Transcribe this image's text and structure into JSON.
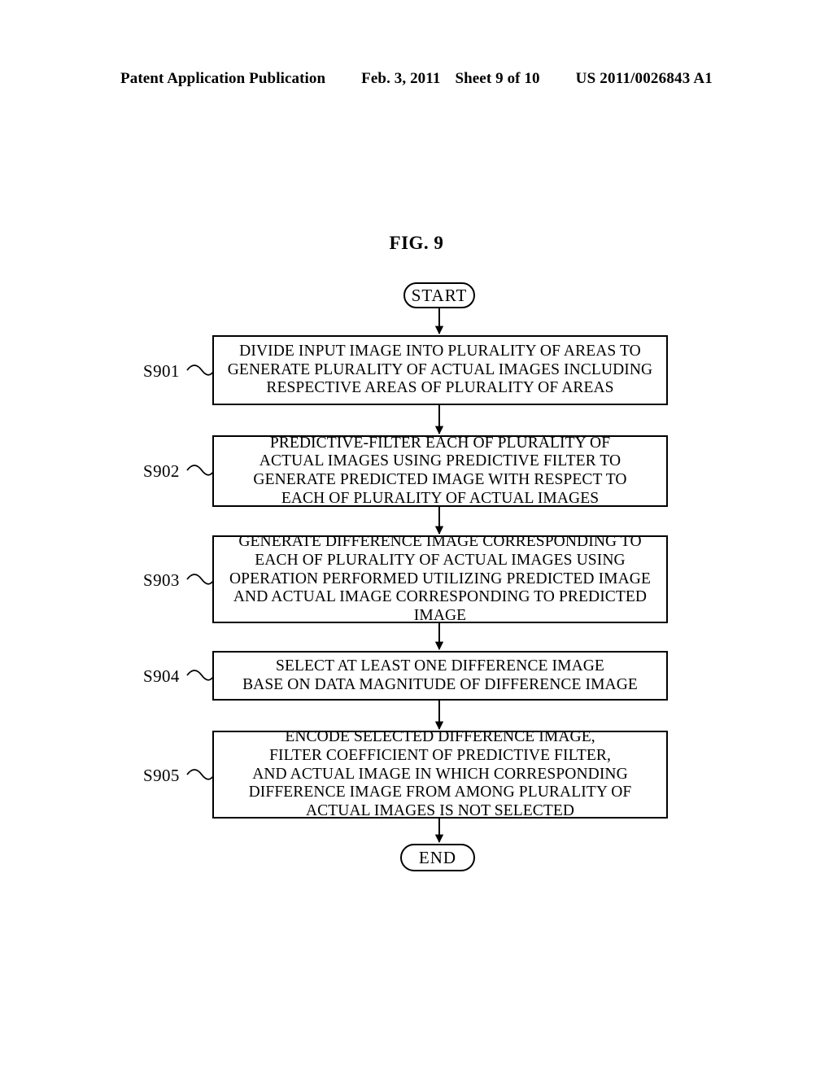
{
  "header": {
    "publication": "Patent Application Publication",
    "date": "Feb. 3, 2011",
    "sheet": "Sheet 9 of 10",
    "patent_number": "US 2011/0026843 A1"
  },
  "figure": {
    "title": "FIG. 9"
  },
  "flowchart": {
    "start_label": "START",
    "end_label": "END",
    "steps": [
      {
        "ref": "S901",
        "text": "DIVIDE INPUT IMAGE INTO PLURALITY OF AREAS TO\nGENERATE PLURALITY OF ACTUAL IMAGES INCLUDING\nRESPECTIVE AREAS OF PLURALITY OF AREAS"
      },
      {
        "ref": "S902",
        "text": "PREDICTIVE-FILTER EACH OF PLURALITY OF\nACTUAL IMAGES USING PREDICTIVE FILTER TO\nGENERATE PREDICTED  IMAGE WITH RESPECT TO\nEACH OF PLURALITY OF ACTUAL IMAGES"
      },
      {
        "ref": "S903",
        "text": "GENERATE DIFFERENCE IMAGE CORRESPONDING TO\nEACH OF PLURALITY OF ACTUAL IMAGES USING\nOPERATION PERFORMED UTILIZING PREDICTED  IMAGE\nAND ACTUAL IMAGE CORRESPONDING TO PREDICTED\nIMAGE"
      },
      {
        "ref": "S904",
        "text": "SELECT AT LEAST ONE DIFFERENCE IMAGE\nBASE ON DATA MAGNITUDE OF DIFFERENCE IMAGE"
      },
      {
        "ref": "S905",
        "text": "ENCODE SELECTED DIFFERENCE IMAGE,\nFILTER COEFFICIENT OF PREDICTIVE FILTER,\nAND ACTUAL IMAGE IN WHICH CORRESPONDING\nDIFFERENCE IMAGE FROM AMONG PLURALITY OF\nACTUAL IMAGES IS NOT SELECTED"
      }
    ]
  },
  "colors": {
    "ink": "#000000",
    "paper": "#ffffff"
  }
}
